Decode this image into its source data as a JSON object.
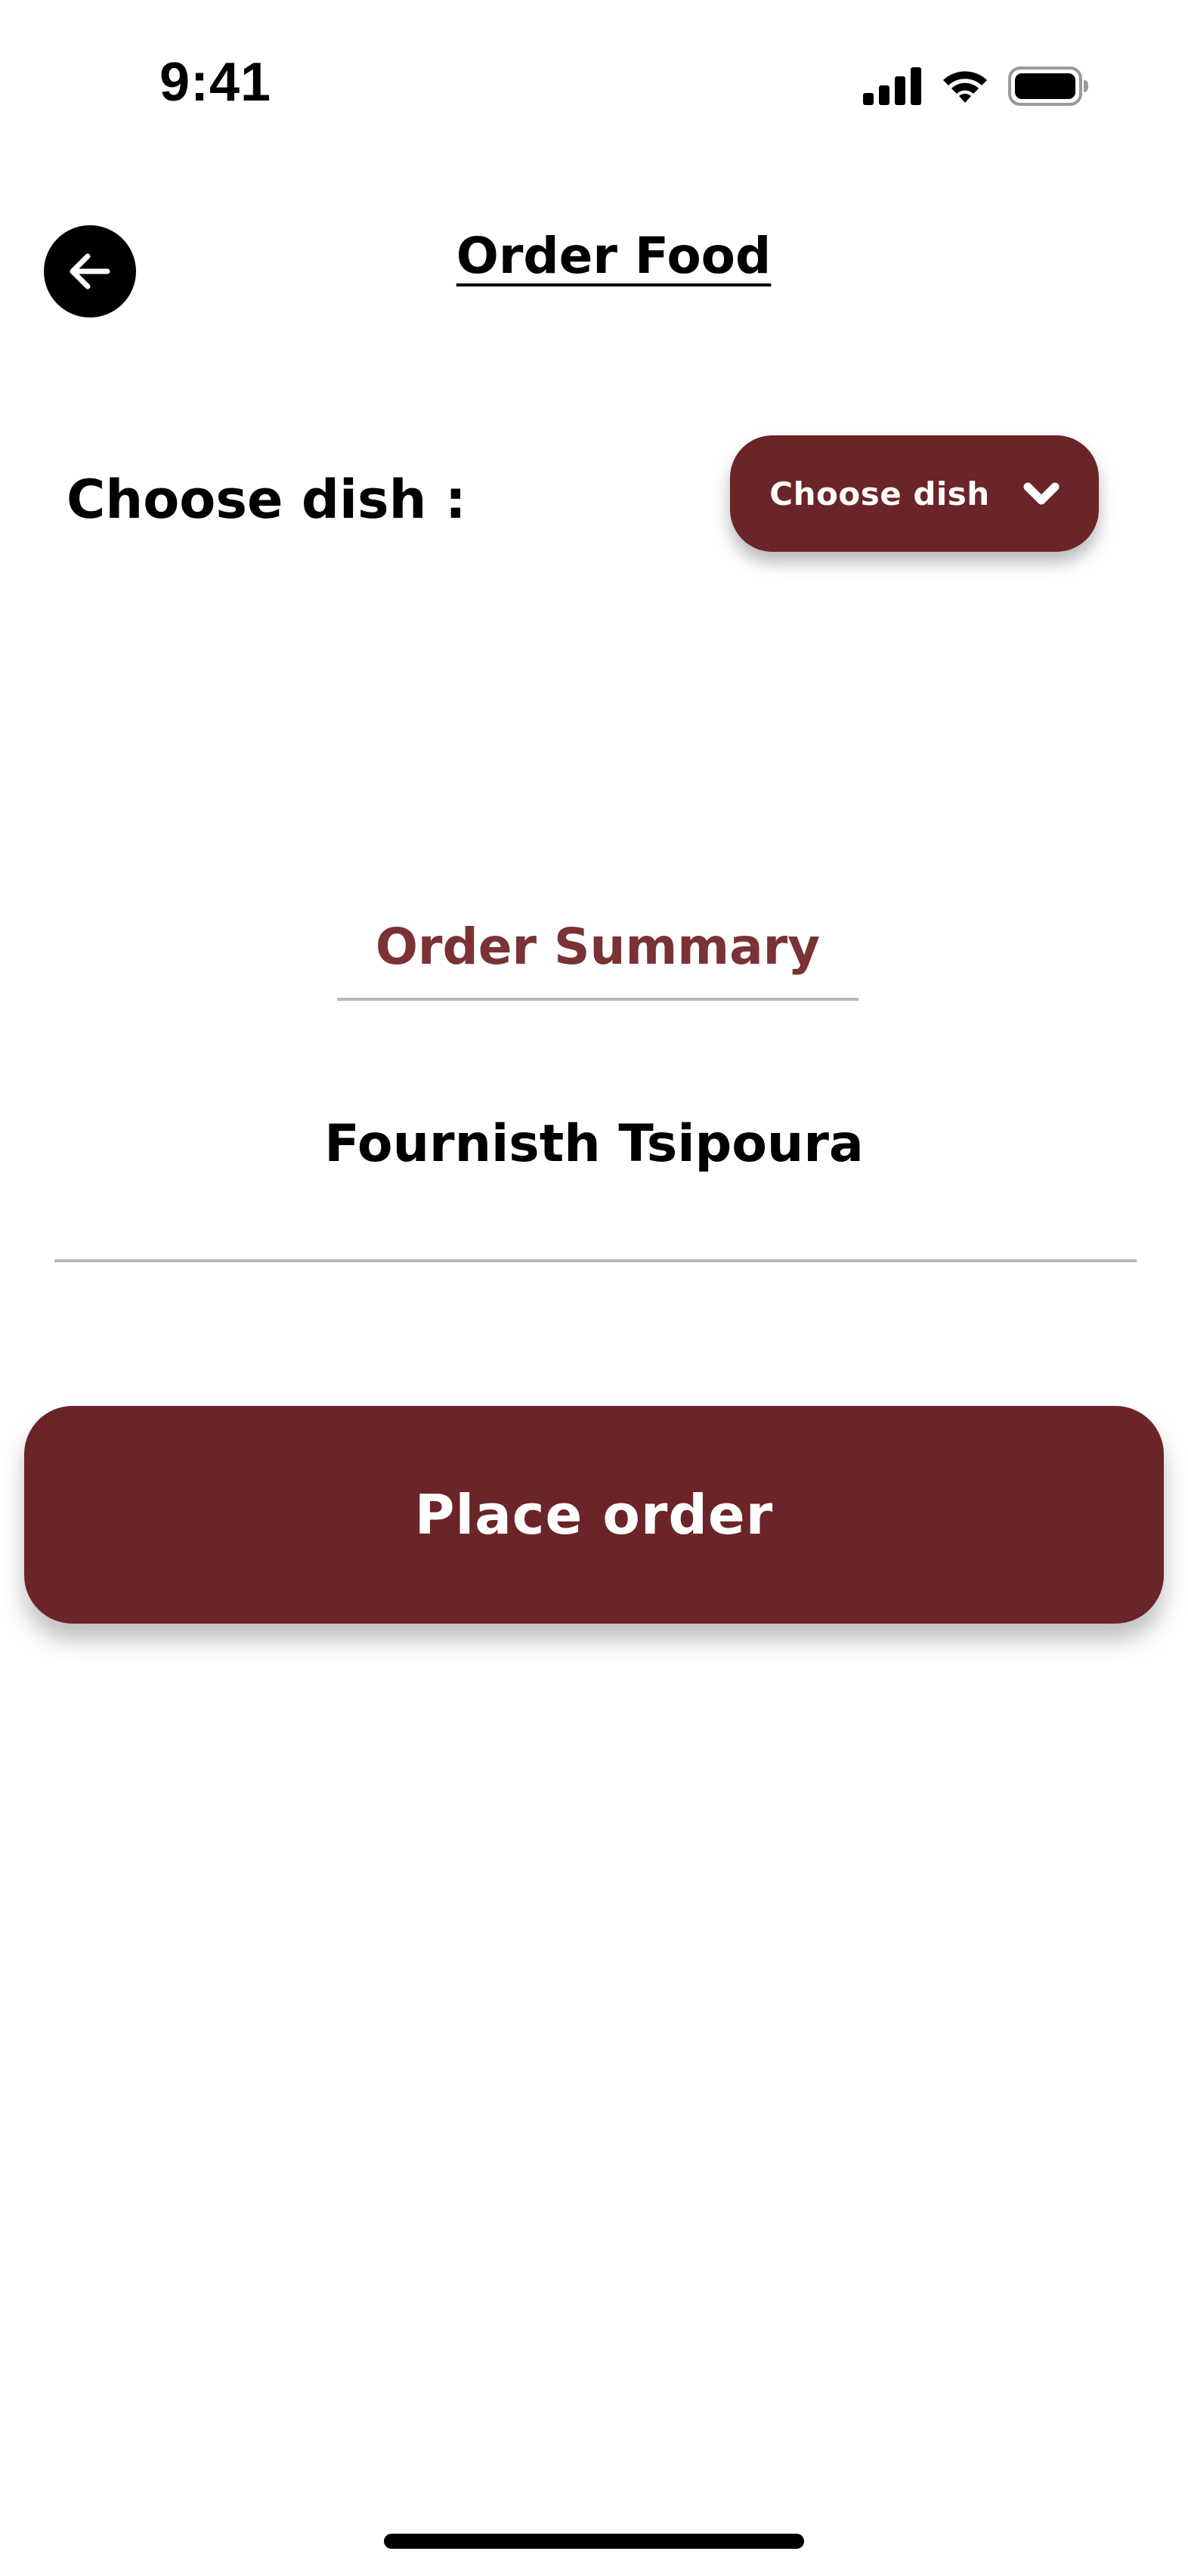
{
  "status_bar": {
    "time": "9:41",
    "icons": [
      "signal-icon",
      "wifi-icon",
      "battery-icon"
    ]
  },
  "header": {
    "title": "Order Food",
    "back_icon": "arrow-left-icon"
  },
  "choose": {
    "label": "Choose dish :",
    "button_label": "Choose dish",
    "button_icon": "chevron-down-icon"
  },
  "summary": {
    "title": "Order Summary",
    "dish": "Fournisth Tsipoura"
  },
  "actions": {
    "place_order_label": "Place order"
  },
  "colors": {
    "accent": "#6b2427",
    "summary_title": "#7a3235",
    "divider": "#b8b8b8"
  }
}
